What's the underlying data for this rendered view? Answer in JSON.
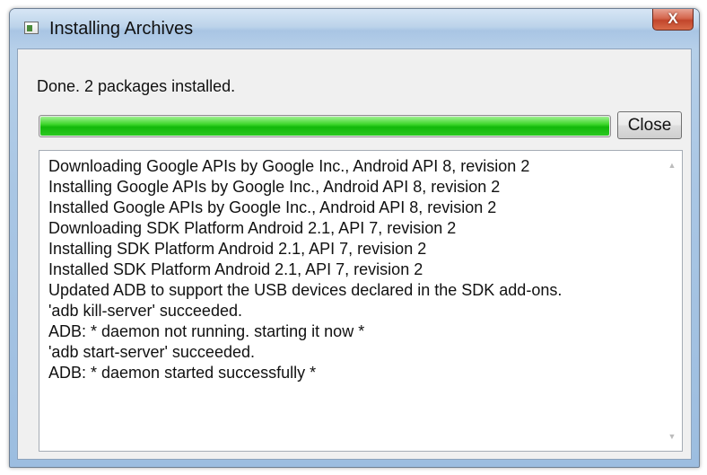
{
  "window": {
    "title": "Installing Archives",
    "close_glyph": "X"
  },
  "status": {
    "text": "Done. 2 packages installed.",
    "progress_fraction": 1.0,
    "progress_color": "#22c414"
  },
  "actions": {
    "close_label": "Close"
  },
  "log": {
    "lines": [
      "Downloading Google APIs by Google Inc., Android API 8, revision 2",
      "Installing Google APIs by Google Inc., Android API 8, revision 2",
      "Installed Google APIs by Google Inc., Android API 8, revision 2",
      "Downloading SDK Platform Android 2.1, API 7, revision 2",
      "Installing SDK Platform Android 2.1, API 7, revision 2",
      "Installed SDK Platform Android 2.1, API 7, revision 2",
      "Updated ADB to support the USB devices declared in the SDK add-ons.",
      "'adb kill-server' succeeded.",
      "ADB: * daemon not running. starting it now *",
      "'adb start-server' succeeded.",
      "ADB: * daemon started successfully *"
    ]
  },
  "icons": {
    "app": "window-app-icon",
    "scroll_up": "scroll-up-arrow-icon",
    "scroll_down": "scroll-down-arrow-icon"
  }
}
